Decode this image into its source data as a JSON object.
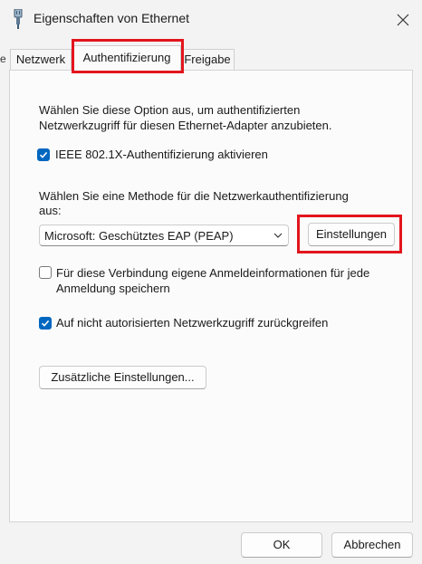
{
  "window": {
    "title": "Eigenschaften von Ethernet"
  },
  "tabs": [
    {
      "label": "Netzwerk"
    },
    {
      "label": "Authentifizierung"
    },
    {
      "label": "Freigabe"
    }
  ],
  "left_stub": "e",
  "auth": {
    "intro_line1": "Wählen Sie diese Option aus, um authentifizierten",
    "intro_line2": "Netzwerkzugriff für diesen Ethernet-Adapter anzubieten.",
    "ieee_checkbox_label": "IEEE 802.1X-Authentifizierung aktivieren",
    "method_label_line1": "Wählen Sie eine Methode für die Netzwerkauthentifizierung",
    "method_label_line2": "aus:",
    "method_selected": "Microsoft: Geschütztes EAP (PEAP)",
    "settings_button": "Einstellungen",
    "remember_label_line1": "Für diese Verbindung eigene Anmeldeinformationen für jede",
    "remember_label_line2": "Anmeldung speichern",
    "fallback_label": "Auf nicht autorisierten Netzwerkzugriff zurückgreifen",
    "additional_button": "Zusätzliche Einstellungen..."
  },
  "checkbox_states": {
    "ieee": true,
    "remember": false,
    "fallback": true
  },
  "footer": {
    "ok_label": "OK",
    "cancel_label": "Abbrechen"
  },
  "colors": {
    "accent": "#0067c0",
    "highlight": "#e3151d"
  },
  "icons": {
    "app": "ethernet-plug-icon",
    "close": "close-icon",
    "dropdown": "chevron-down-icon",
    "check": "checkmark-icon"
  }
}
